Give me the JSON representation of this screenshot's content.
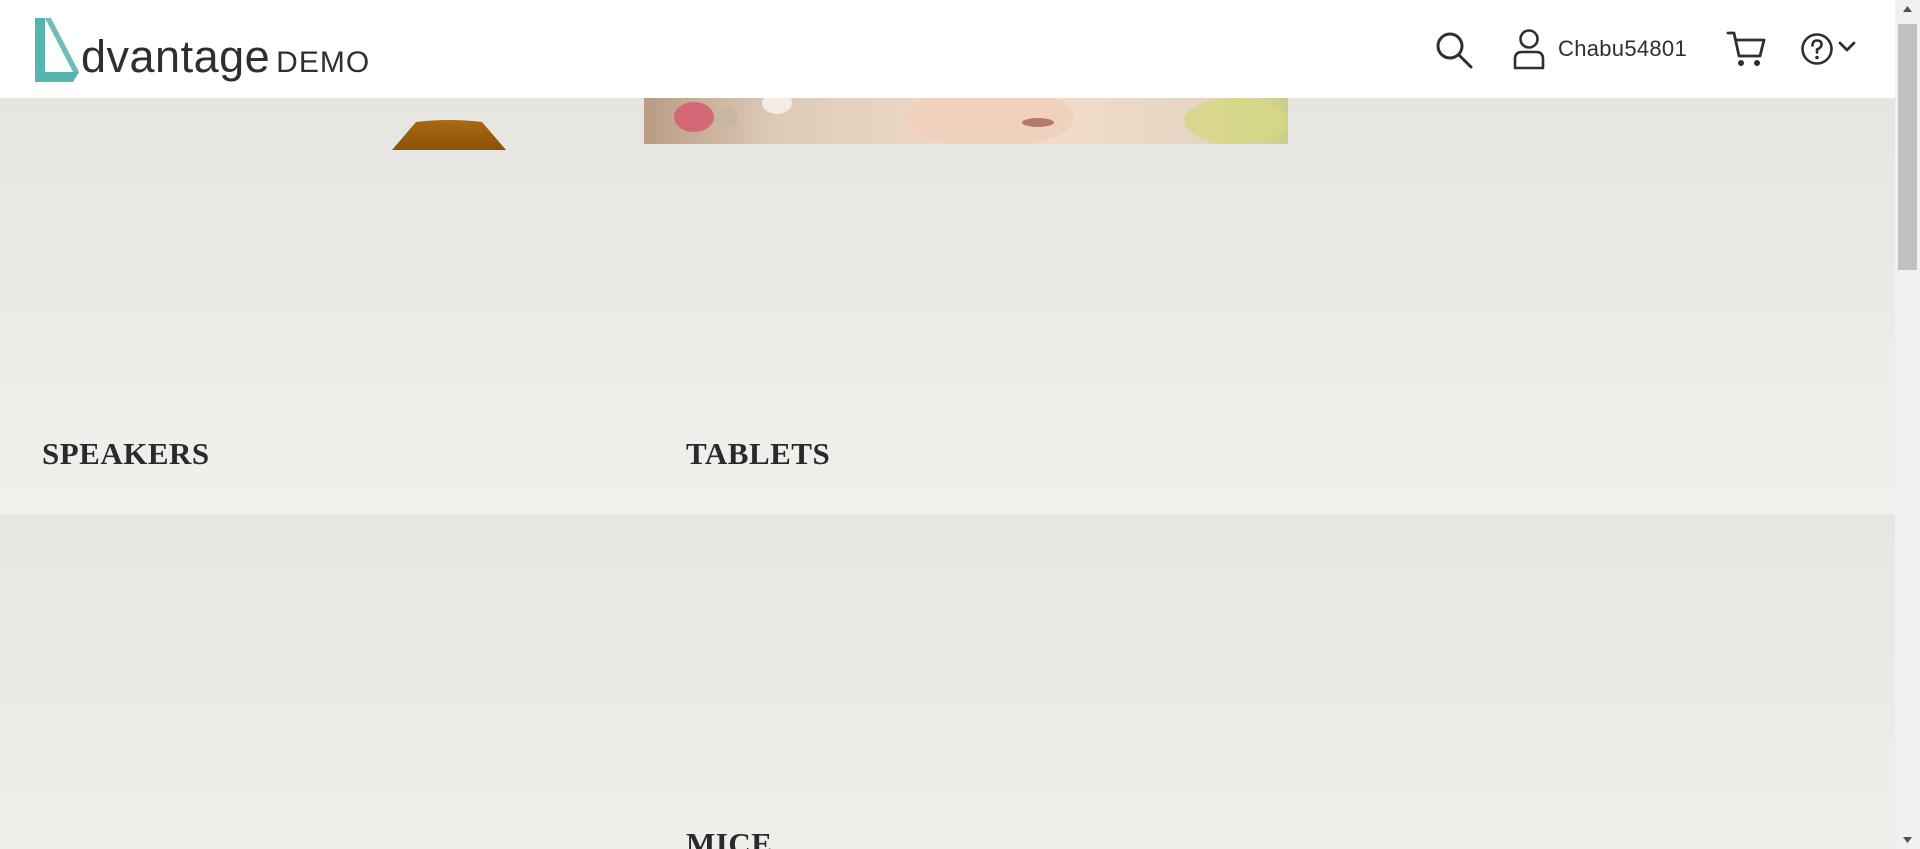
{
  "header": {
    "logo": {
      "word": "dvantage",
      "demo": "DEMO",
      "accent_color": "#56b3ad"
    },
    "user": {
      "username": "Chabu54801"
    },
    "icons": [
      "search-icon",
      "user-icon",
      "cart-icon",
      "help-icon",
      "chevron-down-icon"
    ]
  },
  "categories": [
    {
      "label": "SPEAKERS"
    },
    {
      "label": "TABLETS"
    },
    {
      "label": "MICE"
    }
  ],
  "colors": {
    "background": "#edebe7",
    "header_bg": "#ffffff",
    "text": "#2a2a2a"
  }
}
